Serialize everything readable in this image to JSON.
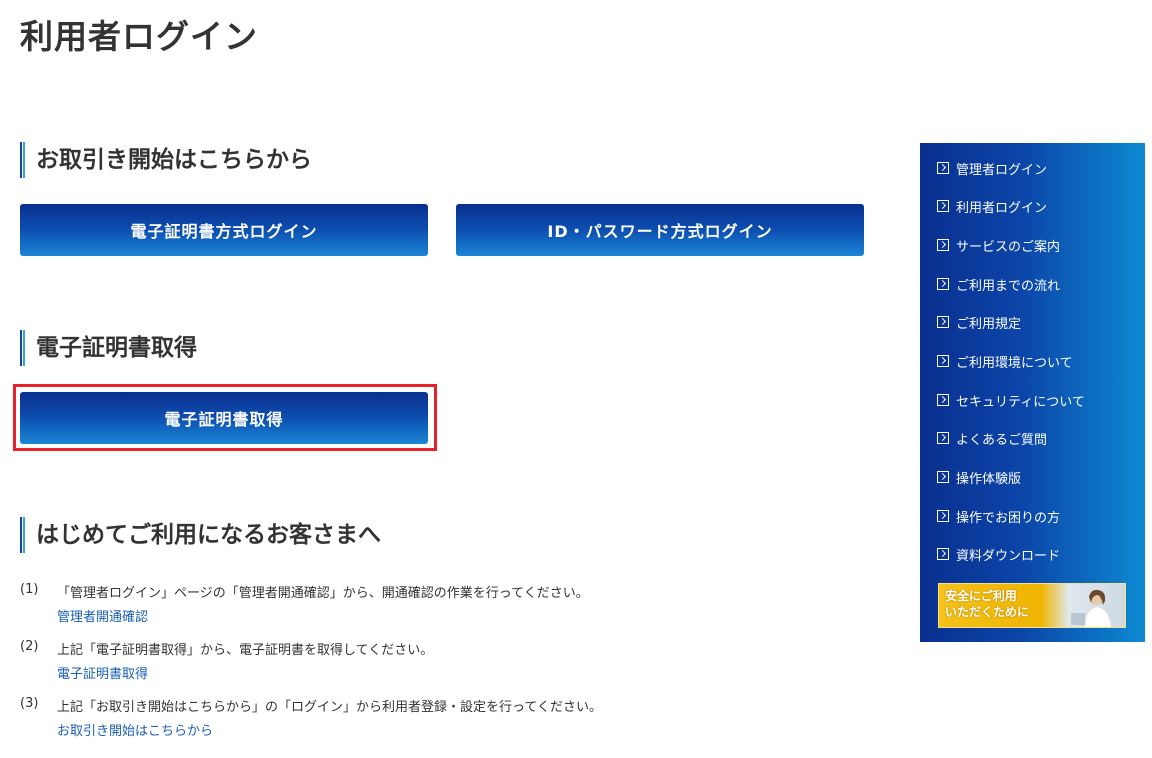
{
  "page": {
    "title": "利用者ログイン"
  },
  "section_start": {
    "heading": "お取引き開始はこちらから",
    "cert_login_label": "電子証明書方式ログイン",
    "id_login_label": "ID・パスワード方式ログイン"
  },
  "section_cert": {
    "heading": "電子証明書取得",
    "button_label": "電子証明書取得"
  },
  "section_first": {
    "heading": "はじめてご利用になるお客さまへ",
    "steps": [
      {
        "num": "(1)",
        "text": "「管理者ログイン」ページの「管理者開通確認」から、開通確認の作業を行ってください。",
        "link": "管理者開通確認"
      },
      {
        "num": "(2)",
        "text": "上記「電子証明書取得」から、電子証明書を取得してください。",
        "link": "電子証明書取得"
      },
      {
        "num": "(3)",
        "text": "上記「お取引き開始はこちらから」の「ログイン」から利用者登録・設定を行ってください。",
        "link": "お取引き開始はこちらから"
      }
    ]
  },
  "sidebar": {
    "items": [
      {
        "label": "管理者ログイン",
        "icon": "arrow-right-square-icon"
      },
      {
        "label": "利用者ログイン",
        "icon": "arrow-right-square-icon"
      },
      {
        "label": "サービスのご案内",
        "icon": "arrow-right-square-icon"
      },
      {
        "label": "ご利用までの流れ",
        "icon": "arrow-right-square-icon"
      },
      {
        "label": "ご利用規定",
        "icon": "arrow-right-square-icon"
      },
      {
        "label": "ご利用環境について",
        "icon": "arrow-right-square-icon"
      },
      {
        "label": "セキュリティについて",
        "icon": "arrow-right-square-icon"
      },
      {
        "label": "よくあるご質問",
        "icon": "arrow-right-square-icon"
      },
      {
        "label": "操作体験版",
        "icon": "arrow-right-square-icon"
      },
      {
        "label": "操作でお困りの方",
        "icon": "arrow-right-square-icon"
      },
      {
        "label": "資料ダウンロード",
        "icon": "arrow-right-square-icon"
      }
    ],
    "banner_text": "安全にご利用\nいただくために"
  },
  "colors": {
    "button_dark": "#0a2f8f",
    "button_light": "#1a86d6",
    "highlight_border": "#e8202a",
    "link": "#1a5fb4",
    "sidebar_dark": "#0a2f8f",
    "sidebar_light": "#0d8ad2"
  }
}
